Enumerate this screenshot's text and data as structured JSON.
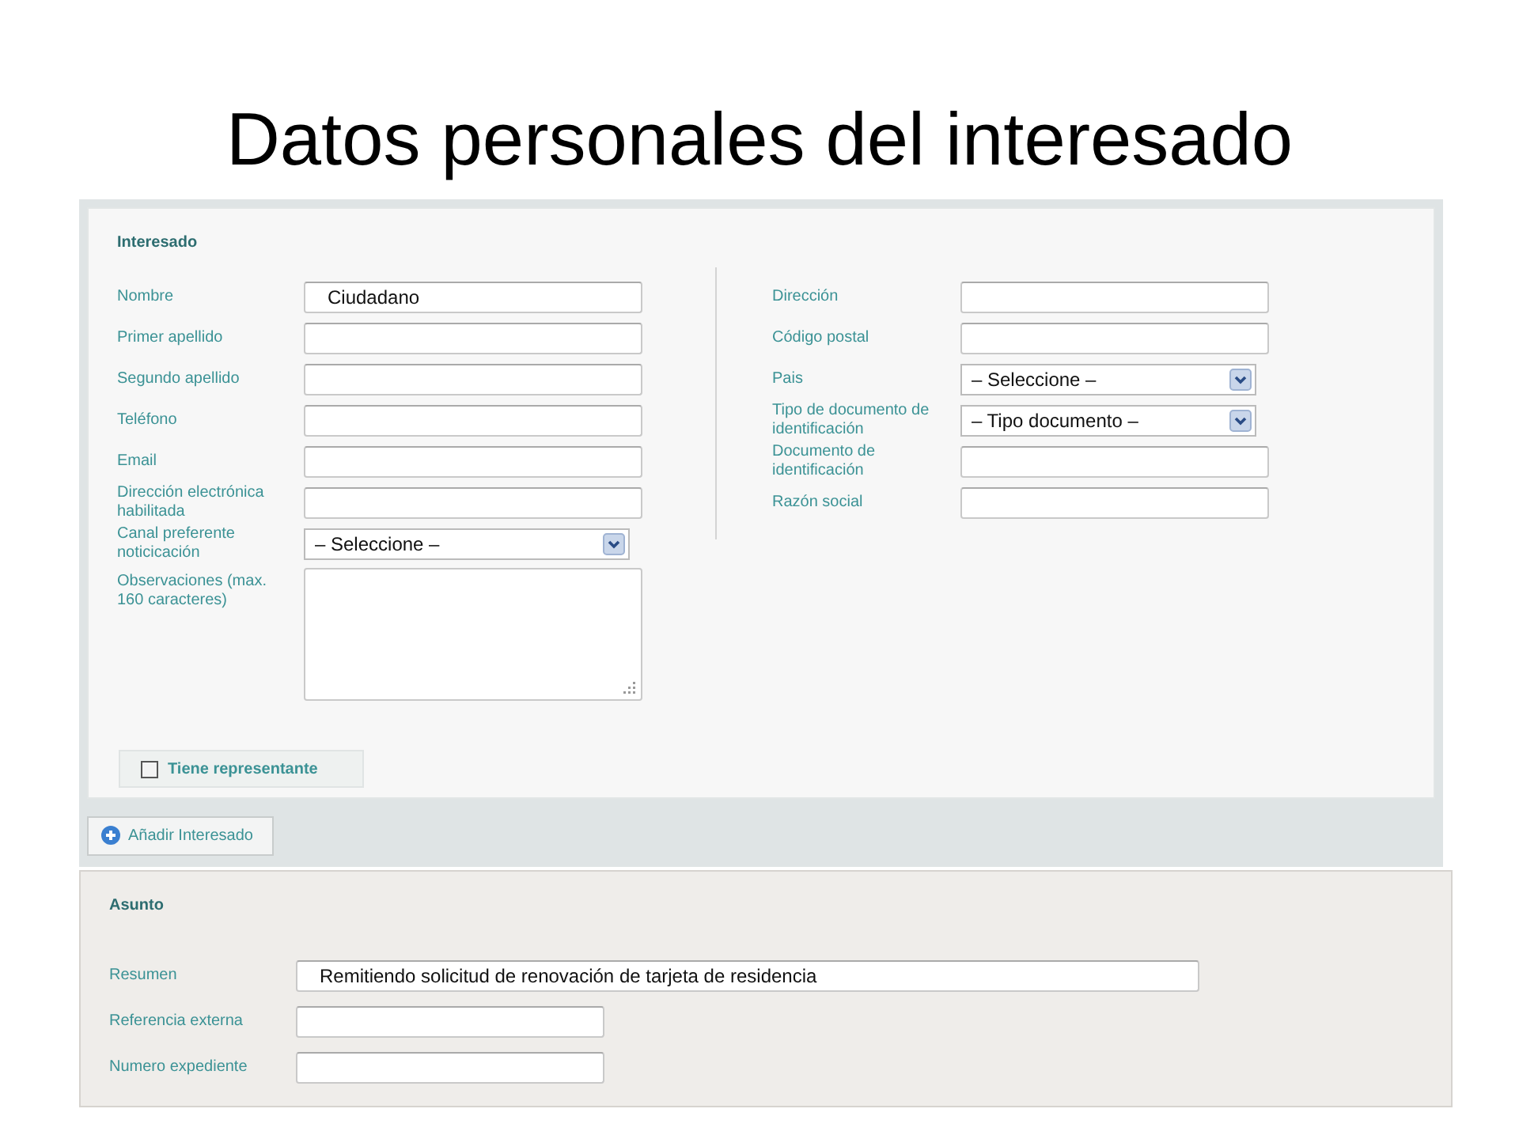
{
  "slide_title": "Datos personales del interesado",
  "interesado": {
    "title": "Interesado",
    "left_fields": [
      {
        "label": "Nombre",
        "kind": "text",
        "value": "Ciudadano"
      },
      {
        "label": "Primer apellido",
        "kind": "text"
      },
      {
        "label": "Segundo apellido",
        "kind": "text"
      },
      {
        "label": "Teléfono",
        "kind": "text"
      },
      {
        "label": "Email",
        "kind": "text"
      },
      {
        "label": "Dirección electrónica habilitada",
        "kind": "text"
      },
      {
        "label": "Canal preferente noticicación",
        "kind": "select",
        "value": "– Seleccione –"
      },
      {
        "label": "Observaciones (max. 160 caracteres)",
        "kind": "textarea"
      }
    ],
    "right_fields": [
      {
        "label": "Dirección",
        "kind": "text"
      },
      {
        "label": "Código postal",
        "kind": "text"
      },
      {
        "label": "Pais",
        "kind": "select",
        "value": "– Seleccione –"
      },
      {
        "label": "Tipo de documento de identificación",
        "kind": "select",
        "value": "– Tipo documento –"
      },
      {
        "label": "Documento de identificación",
        "kind": "text"
      },
      {
        "label": "Razón social",
        "kind": "text"
      }
    ],
    "representative": {
      "label": "Tiene representante",
      "checked": false
    }
  },
  "add_button": {
    "label": "Añadir Interesado"
  },
  "asunto": {
    "title": "Asunto",
    "fields": [
      {
        "label": "Resumen",
        "kind": "wide_text",
        "value": "Remitiendo solicitud de renovación de tarjeta de residencia"
      },
      {
        "label": "Referencia externa",
        "kind": "text"
      },
      {
        "label": "Numero expediente",
        "kind": "text"
      }
    ]
  }
}
